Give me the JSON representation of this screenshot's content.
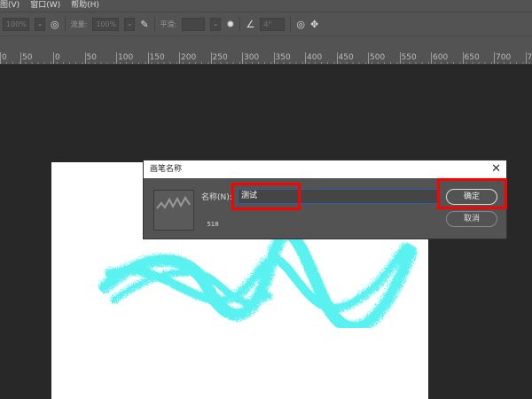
{
  "menu": [
    "图(V)",
    "窗口(W)",
    "帮助(H)"
  ],
  "toolbar": {
    "opacity": "100%",
    "flow_label": "流量:",
    "flow": "100%",
    "smooth_label": "平滑:",
    "smooth": "",
    "angle": "4°"
  },
  "ruler": [
    "0",
    "50",
    "0",
    "50",
    "100",
    "150",
    "200",
    "250",
    "300",
    "350",
    "400",
    "450",
    "500",
    "550",
    "600",
    "650",
    "700",
    "750"
  ],
  "dialog": {
    "title": "画笔名称",
    "close": "✕",
    "brush_size": "518",
    "name_label": "名称(N):",
    "name_value": "测试",
    "ok": "确定",
    "cancel": "取消"
  },
  "colors": {
    "stroke": "#3ef0ef",
    "highlight": "#ff0000"
  }
}
